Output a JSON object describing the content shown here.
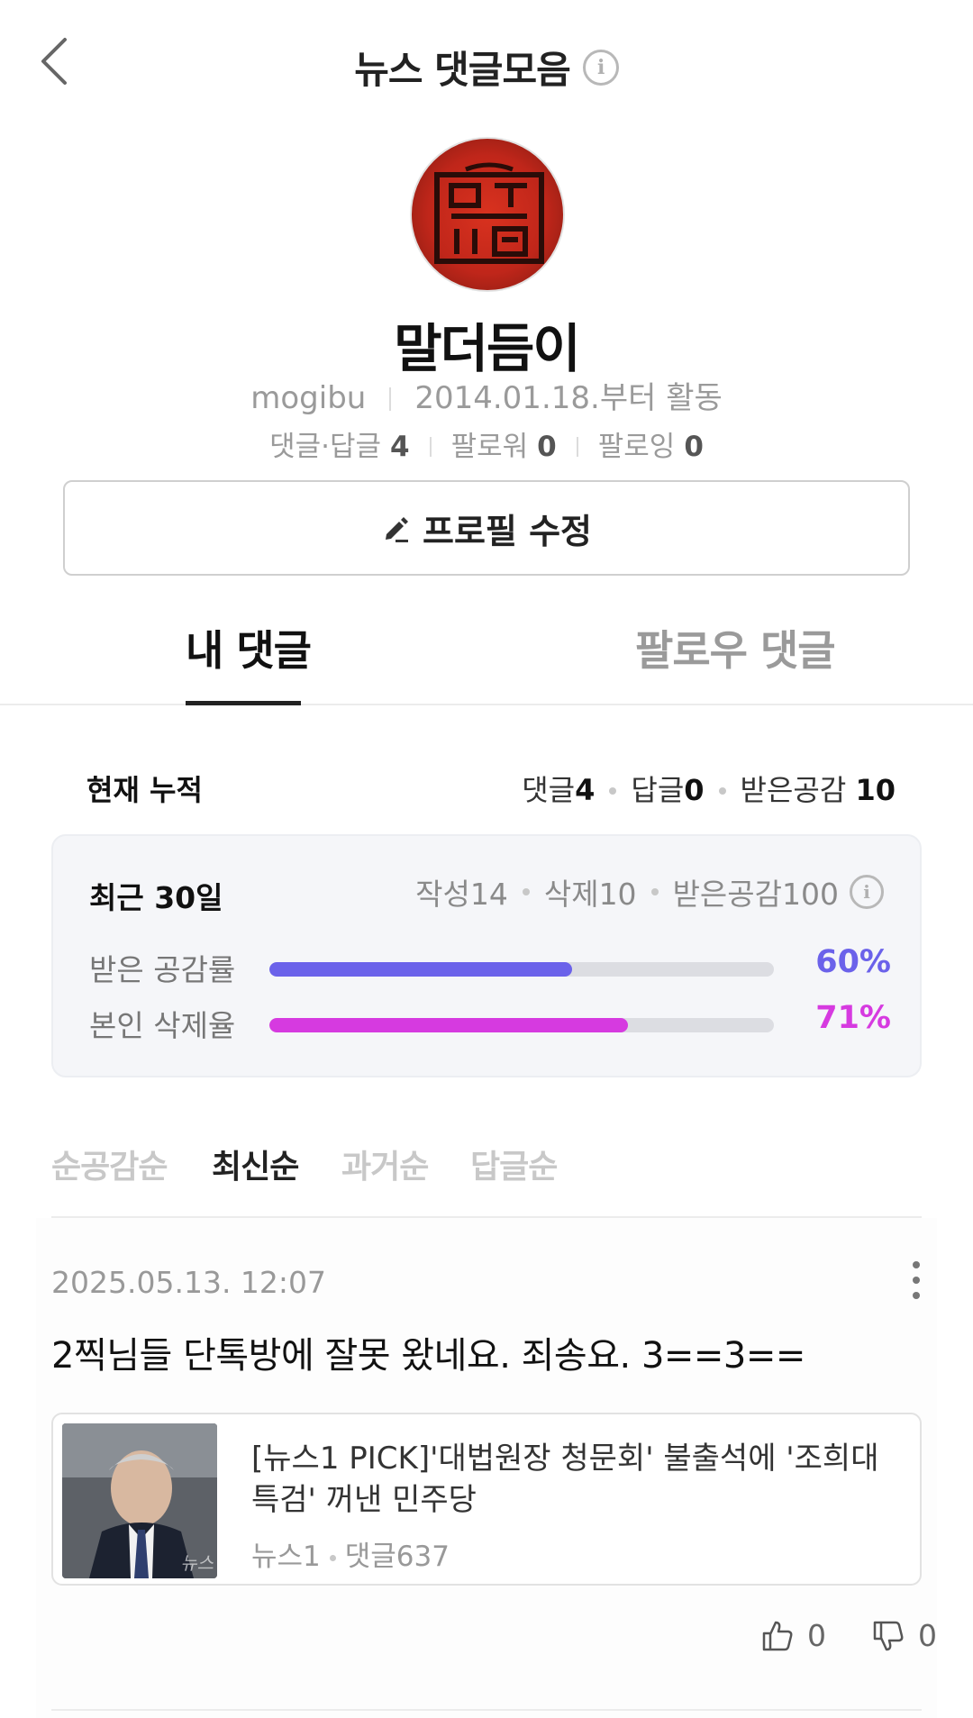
{
  "header": {
    "title": "뉴스 댓글모음",
    "info_glyph": "i"
  },
  "profile": {
    "nickname": "말더듬이",
    "user_id": "mogibu",
    "since": "2014.01.18.부터 활동",
    "comments_label": "댓글·답글",
    "comments_count": "4",
    "followers_label": "팔로워",
    "followers_count": "0",
    "following_label": "팔로잉",
    "following_count": "0",
    "edit_button": "프로필 수정"
  },
  "tabs": [
    {
      "label": "내 댓글",
      "active": true
    },
    {
      "label": "팔로우 댓글",
      "active": false
    }
  ],
  "summary": {
    "label": "현재 누적",
    "comments_label": "댓글",
    "comments_value": "4",
    "replies_label": "답글",
    "replies_value": "0",
    "likes_label": "받은공감",
    "likes_value": "10"
  },
  "recent": {
    "title": "최근 30일",
    "written": "작성14",
    "deleted": "삭제10",
    "likes": "받은공감100",
    "like_rate_label": "받은 공감률",
    "like_rate_value": "60%",
    "like_rate_fraction": 0.6,
    "like_rate_color": "#6b62ea",
    "delete_rate_label": "본인 삭제율",
    "delete_rate_value": "71%",
    "delete_rate_fraction": 0.71,
    "delete_rate_color": "#d63ae0"
  },
  "sort": [
    {
      "label": "순공감순",
      "active": false
    },
    {
      "label": "최신순",
      "active": true
    },
    {
      "label": "과거순",
      "active": false
    },
    {
      "label": "답글순",
      "active": false
    }
  ],
  "comment": {
    "date": "2025.05.13. 12:07",
    "text": "2찍님들 단톡방에 잘못 왔네요. 죄송요. 3==3==",
    "news_title": "[뉴스1 PICK]'대법원장 청문회' 불출석에 '조희대 특검' 꺼낸 민주당",
    "news_source": "뉴스1",
    "news_comments": "댓글637",
    "thumb_watermark": "뉴스",
    "likes": "0",
    "dislikes": "0"
  }
}
